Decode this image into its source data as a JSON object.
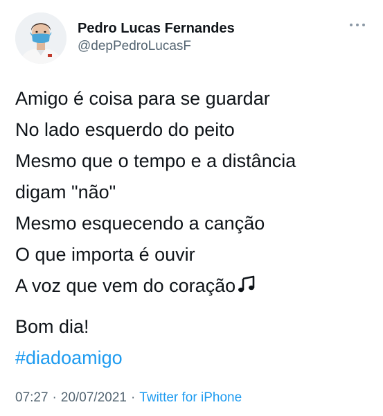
{
  "author": {
    "name": "Pedro Lucas Fernandes",
    "handle": "@depPedroLucasF"
  },
  "tweet": {
    "lines": [
      "Amigo é coisa para se guardar",
      "No lado esquerdo do peito",
      "Mesmo que o tempo e a distância",
      "digam \"não\"",
      "Mesmo esquecendo a canção",
      "O que importa é ouvir",
      "A voz que vem do coração"
    ],
    "greeting": "Bom dia!",
    "hashtag": "#diadoamigo",
    "emoji_icon": "musical-notes-icon"
  },
  "meta": {
    "time": "07:27",
    "date": "20/07/2021",
    "separator": "·",
    "source": "Twitter for iPhone"
  },
  "colors": {
    "link": "#1d9bf0",
    "secondary_text": "#536471",
    "primary_text": "#0f1419",
    "mask": "#4aa6d8"
  }
}
